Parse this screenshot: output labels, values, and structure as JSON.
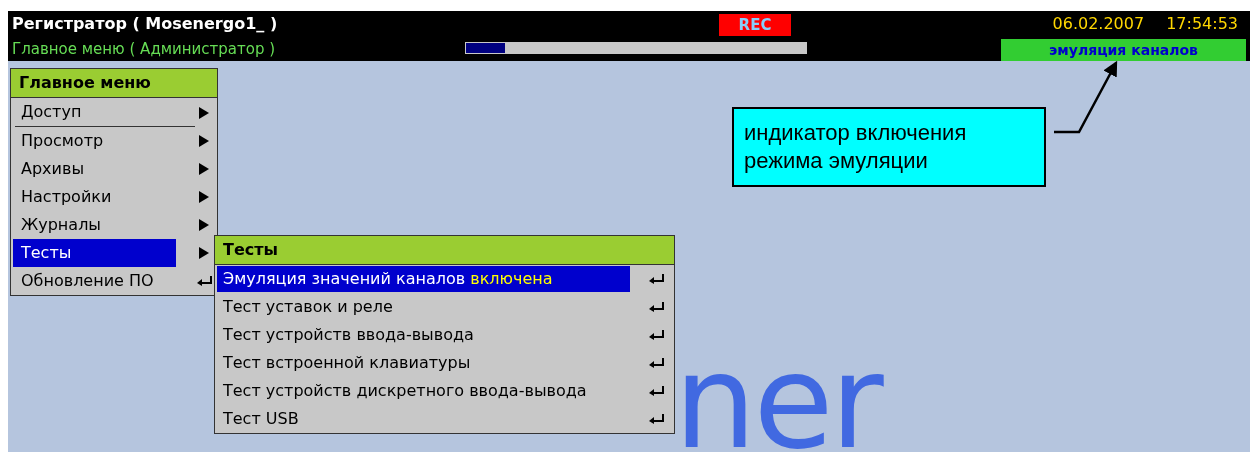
{
  "header": {
    "title": "Регистратор ( Mosenergo1_ )",
    "subtitle": "Главное меню ( Администратор )",
    "rec": "REC",
    "progress": {
      "level": 0.12
    },
    "date": "06.02.2007",
    "time": "17:54:53",
    "emulation_indicator": "эмуляция каналов"
  },
  "background_logo": "ner",
  "main_menu": {
    "title": "Главное меню",
    "items": [
      {
        "label": "Доступ",
        "kind": "submenu",
        "selected": false,
        "separator_after": true
      },
      {
        "label": "Просмотр",
        "kind": "submenu",
        "selected": false,
        "separator_after": false
      },
      {
        "label": "Архивы",
        "kind": "submenu",
        "selected": false,
        "separator_after": false
      },
      {
        "label": "Настройки",
        "kind": "submenu",
        "selected": false,
        "separator_after": false
      },
      {
        "label": "Журналы",
        "kind": "submenu",
        "selected": false,
        "separator_after": false
      },
      {
        "label": "Тесты",
        "kind": "submenu",
        "selected": true,
        "separator_after": false
      },
      {
        "label": "Обновление ПО",
        "kind": "action",
        "selected": false,
        "separator_after": false
      }
    ]
  },
  "tests_menu": {
    "title": "Тесты",
    "items": [
      {
        "label": "Эмуляция значений каналов",
        "status": "включена",
        "kind": "action",
        "selected": true
      },
      {
        "label": "Тест уставок и реле",
        "kind": "action",
        "selected": false
      },
      {
        "label": "Тест устройств ввода-вывода",
        "kind": "action",
        "selected": false
      },
      {
        "label": "Тест встроенной клавиатуры",
        "kind": "action",
        "selected": false
      },
      {
        "label": "Тест устройств дискретного ввода-вывода",
        "kind": "action",
        "selected": false
      },
      {
        "label": "Тест USB",
        "kind": "action",
        "selected": false
      }
    ]
  },
  "callout": {
    "text": "индикатор включения режима эмуляции"
  }
}
